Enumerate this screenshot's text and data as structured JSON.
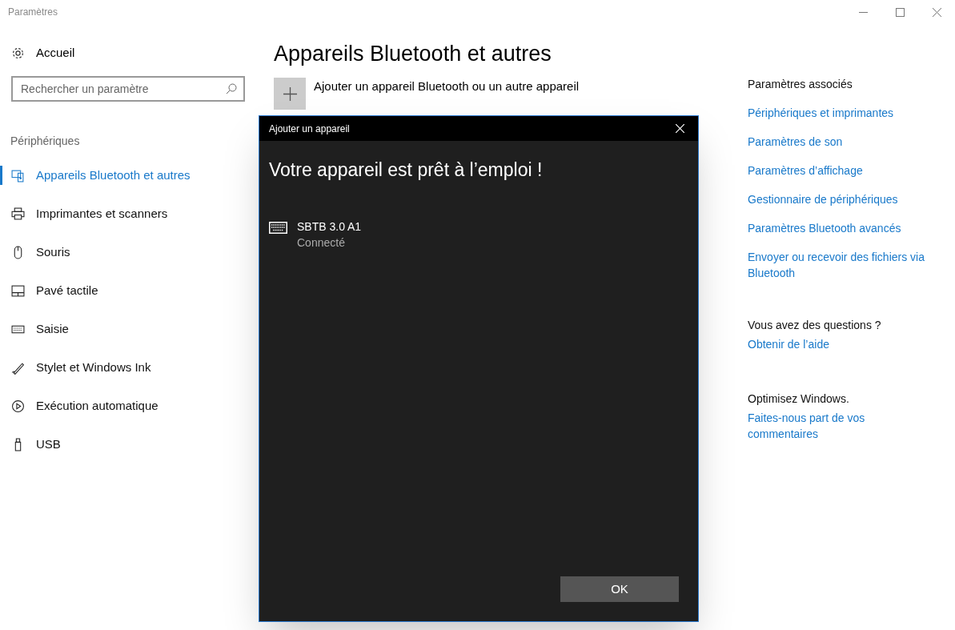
{
  "window": {
    "title": "Paramètres"
  },
  "sidebar": {
    "home": "Accueil",
    "search": {
      "placeholder": "Rechercher un paramètre"
    },
    "section": "Périphériques",
    "items": [
      {
        "label": "Appareils Bluetooth et autres",
        "selected": true
      },
      {
        "label": "Imprimantes et scanners",
        "selected": false
      },
      {
        "label": "Souris",
        "selected": false
      },
      {
        "label": "Pavé tactile",
        "selected": false
      },
      {
        "label": "Saisie",
        "selected": false
      },
      {
        "label": "Stylet et Windows Ink",
        "selected": false
      },
      {
        "label": "Exécution automatique",
        "selected": false
      },
      {
        "label": "USB",
        "selected": false
      }
    ]
  },
  "content": {
    "title": "Appareils Bluetooth et autres",
    "add_device": "Ajouter un appareil Bluetooth ou un autre appareil"
  },
  "related": [
    {
      "heading": "Paramètres associés",
      "links": [
        "Périphériques et imprimantes",
        "Paramètres de son",
        "Paramètres d’affichage",
        "Gestionnaire de périphériques",
        "Paramètres Bluetooth avancés",
        "Envoyer ou recevoir des fichiers via Bluetooth"
      ]
    },
    {
      "heading": "Vous avez des questions ?",
      "links": [
        "Obtenir de l’aide"
      ]
    },
    {
      "heading": "Optimisez Windows.",
      "links": [
        "Faites-nous part de vos commentaires"
      ]
    }
  ],
  "dialog": {
    "title": "Ajouter un appareil",
    "heading": "Votre appareil est prêt à l’emploi !",
    "device": {
      "name": "SBTB 3.0 A1",
      "status": "Connecté"
    },
    "ok": "OK"
  }
}
